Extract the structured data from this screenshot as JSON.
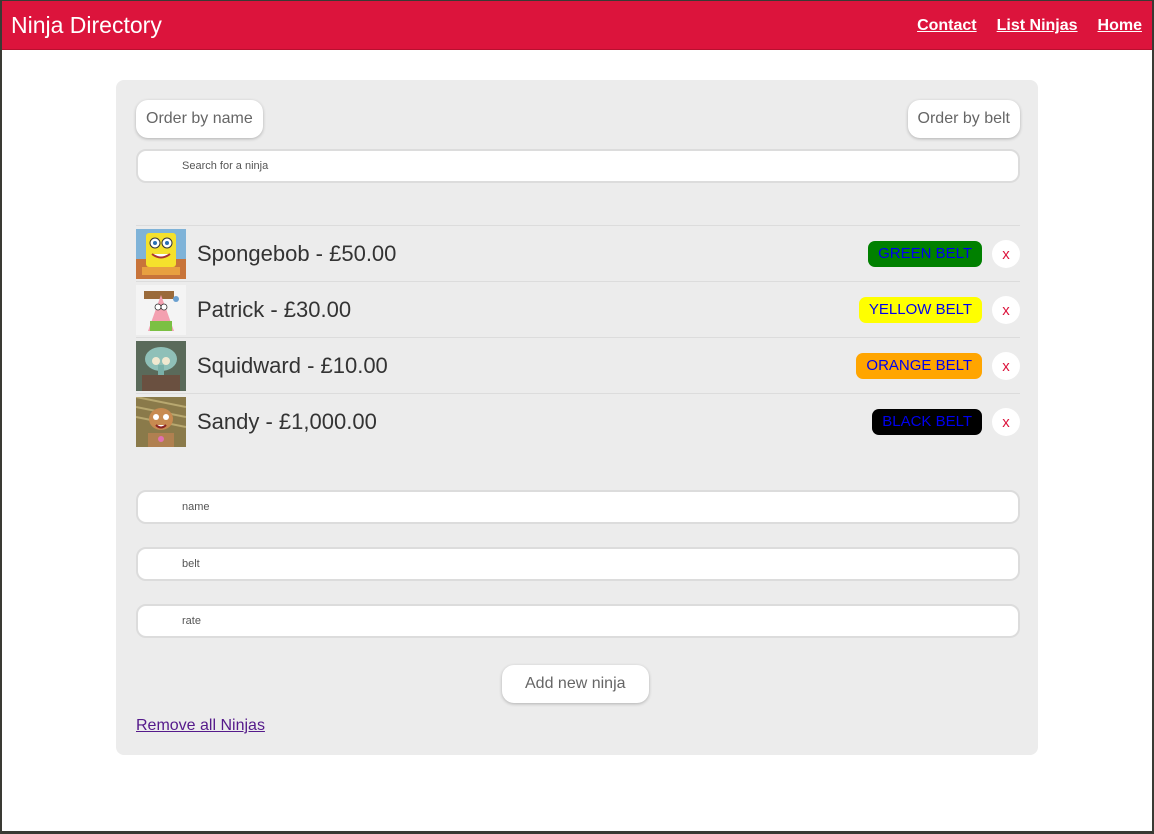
{
  "navbar": {
    "brand": "Ninja Directory",
    "links": [
      "Contact",
      "List Ninjas",
      "Home"
    ]
  },
  "controls": {
    "order_by_name": "Order by name",
    "order_by_belt": "Order by belt",
    "search_placeholder": "Search for a ninja"
  },
  "ninjas": [
    {
      "label": "Spongebob - £50.00",
      "belt": "GREEN BELT",
      "belt_color": "#008000",
      "avatar": "spongebob-avatar"
    },
    {
      "label": "Patrick - £30.00",
      "belt": "YELLOW BELT",
      "belt_color": "#ffff00",
      "avatar": "patrick-avatar"
    },
    {
      "label": "Squidward - £10.00",
      "belt": "ORANGE BELT",
      "belt_color": "#ffa500",
      "avatar": "squidward-avatar"
    },
    {
      "label": "Sandy - £1,000.00",
      "belt": "BLACK BELT",
      "belt_color": "#000000",
      "avatar": "sandy-avatar"
    }
  ],
  "delete_label": "x",
  "form": {
    "name_placeholder": "name",
    "belt_placeholder": "belt",
    "rate_placeholder": "rate",
    "add_button": "Add new ninja"
  },
  "remove_all": "Remove all Ninjas",
  "colors": {
    "navbar": "#dc143c",
    "panel": "#ececec",
    "delete": "#dc143c",
    "belt_text": "#0000ee"
  }
}
